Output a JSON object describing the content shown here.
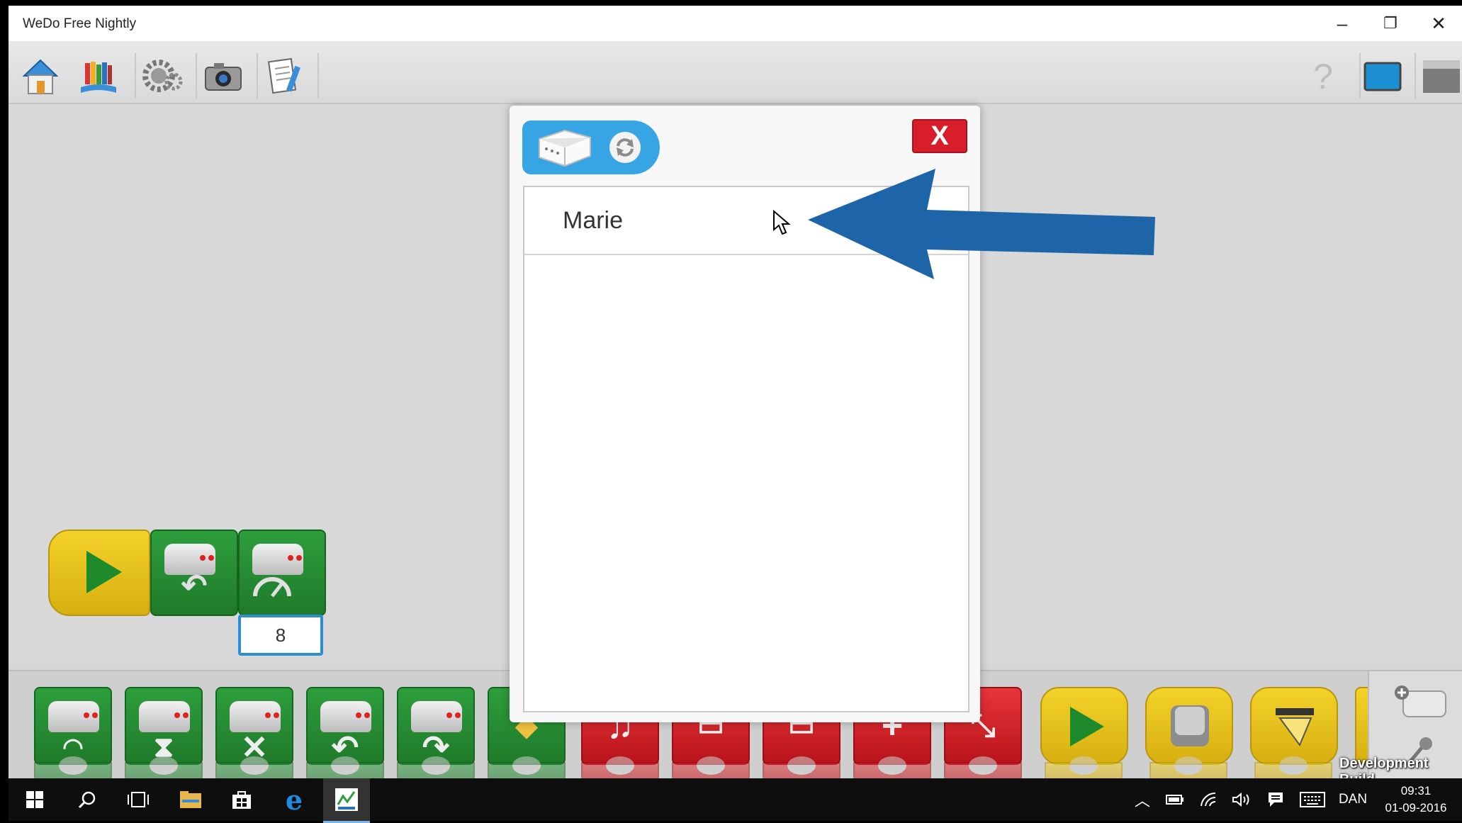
{
  "window": {
    "title": "WeDo Free Nightly",
    "minimize": "–",
    "restore": "❐",
    "close": "✕"
  },
  "toolbar": {
    "left_icons": [
      "home-icon",
      "library-icon",
      "gears-icon",
      "camera-icon",
      "document-icon"
    ],
    "right_icons": [
      "help-icon",
      "screen-mode-icon",
      "toggle-panel-icon"
    ],
    "help_label": "?"
  },
  "program": {
    "blocks": [
      "start-block",
      "motor-direction-block",
      "motor-power-block"
    ],
    "motor_power_value": "8"
  },
  "palette": {
    "green_blocks": [
      "motor-power",
      "motor-on-for",
      "motor-off",
      "motor-direction-left",
      "motor-direction-right",
      "light-color"
    ],
    "red_blocks": [
      "play-sound",
      "display-background",
      "display-text",
      "add-to-display",
      "shrink-display"
    ],
    "yellow_blocks": [
      "start",
      "key-press",
      "message"
    ],
    "side_icons": [
      "add-hub-icon",
      "microphone-icon"
    ]
  },
  "dialog": {
    "devices": [
      {
        "name": "Marie"
      }
    ],
    "close_label": "X",
    "icons": [
      "smarthub-icon",
      "refresh-icon"
    ]
  },
  "overlay": {
    "arrow_color": "#1e64a8",
    "dev_build_label": "Development Build"
  },
  "taskbar": {
    "language": "DAN",
    "time": "09:31",
    "date": "01-09-2016",
    "icons": [
      "windows-start-icon",
      "search-icon",
      "task-view-icon",
      "file-explorer-icon",
      "store-icon",
      "edge-icon",
      "wedo-app-icon",
      "show-hidden-icons-icon",
      "battery-icon",
      "network-icon",
      "volume-icon",
      "action-center-icon",
      "keyboard-icon"
    ]
  },
  "colors": {
    "dialog_accent": "#37a4e4",
    "close_red": "#d81e2a",
    "block_green": "#2e9e3c",
    "block_yellow": "#f3d229",
    "block_red": "#e7363a"
  }
}
